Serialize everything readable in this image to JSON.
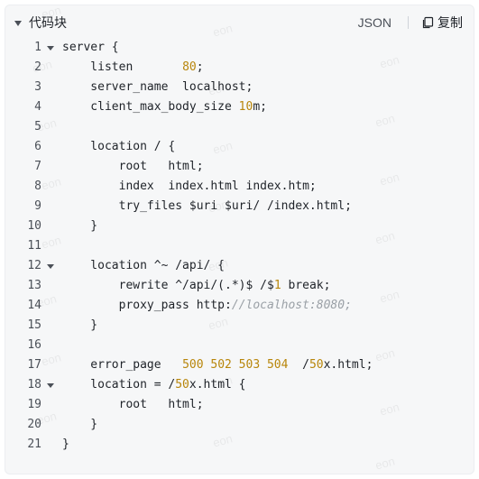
{
  "header": {
    "title": "代码块",
    "language": "JSON",
    "copy_label": "复制"
  },
  "watermark": "eon",
  "code": {
    "lines": [
      {
        "n": "1",
        "fold": true,
        "segments": [
          {
            "t": "server {"
          }
        ]
      },
      {
        "n": "2",
        "fold": false,
        "segments": [
          {
            "t": "    listen       "
          },
          {
            "t": "80",
            "c": "num"
          },
          {
            "t": ";"
          }
        ]
      },
      {
        "n": "3",
        "fold": false,
        "segments": [
          {
            "t": "    server_name  localhost;"
          }
        ]
      },
      {
        "n": "4",
        "fold": false,
        "segments": [
          {
            "t": "    client_max_body_size "
          },
          {
            "t": "10",
            "c": "num"
          },
          {
            "t": "m;"
          }
        ]
      },
      {
        "n": "5",
        "fold": false,
        "segments": []
      },
      {
        "n": "6",
        "fold": false,
        "segments": [
          {
            "t": "    location / {"
          }
        ]
      },
      {
        "n": "7",
        "fold": false,
        "segments": [
          {
            "t": "        root   html;"
          }
        ]
      },
      {
        "n": "8",
        "fold": false,
        "segments": [
          {
            "t": "        index  index.html index.htm;"
          }
        ]
      },
      {
        "n": "9",
        "fold": false,
        "segments": [
          {
            "t": "        try_files $uri $uri/ /index.html;"
          }
        ]
      },
      {
        "n": "10",
        "fold": false,
        "segments": [
          {
            "t": "    }"
          }
        ]
      },
      {
        "n": "11",
        "fold": false,
        "segments": []
      },
      {
        "n": "12",
        "fold": true,
        "segments": [
          {
            "t": "    location ^~ /api/ {"
          }
        ]
      },
      {
        "n": "13",
        "fold": false,
        "segments": [
          {
            "t": "        rewrite ^/api/(.*)$ /$"
          },
          {
            "t": "1",
            "c": "num"
          },
          {
            "t": " break;"
          }
        ]
      },
      {
        "n": "14",
        "fold": false,
        "segments": [
          {
            "t": "        proxy_pass http:"
          },
          {
            "t": "//localhost:8080;",
            "c": "cmt"
          }
        ]
      },
      {
        "n": "15",
        "fold": false,
        "segments": [
          {
            "t": "    }"
          }
        ]
      },
      {
        "n": "16",
        "fold": false,
        "segments": []
      },
      {
        "n": "17",
        "fold": false,
        "segments": [
          {
            "t": "    error_page   "
          },
          {
            "t": "500 502 503 504",
            "c": "num"
          },
          {
            "t": "  /"
          },
          {
            "t": "50",
            "c": "num"
          },
          {
            "t": "x.html;"
          }
        ]
      },
      {
        "n": "18",
        "fold": true,
        "segments": [
          {
            "t": "    location = /"
          },
          {
            "t": "50",
            "c": "num"
          },
          {
            "t": "x.html {"
          }
        ]
      },
      {
        "n": "19",
        "fold": false,
        "segments": [
          {
            "t": "        root   html;"
          }
        ]
      },
      {
        "n": "20",
        "fold": false,
        "segments": [
          {
            "t": "    }"
          }
        ]
      },
      {
        "n": "21",
        "fold": false,
        "segments": [
          {
            "t": "}"
          }
        ]
      }
    ]
  }
}
